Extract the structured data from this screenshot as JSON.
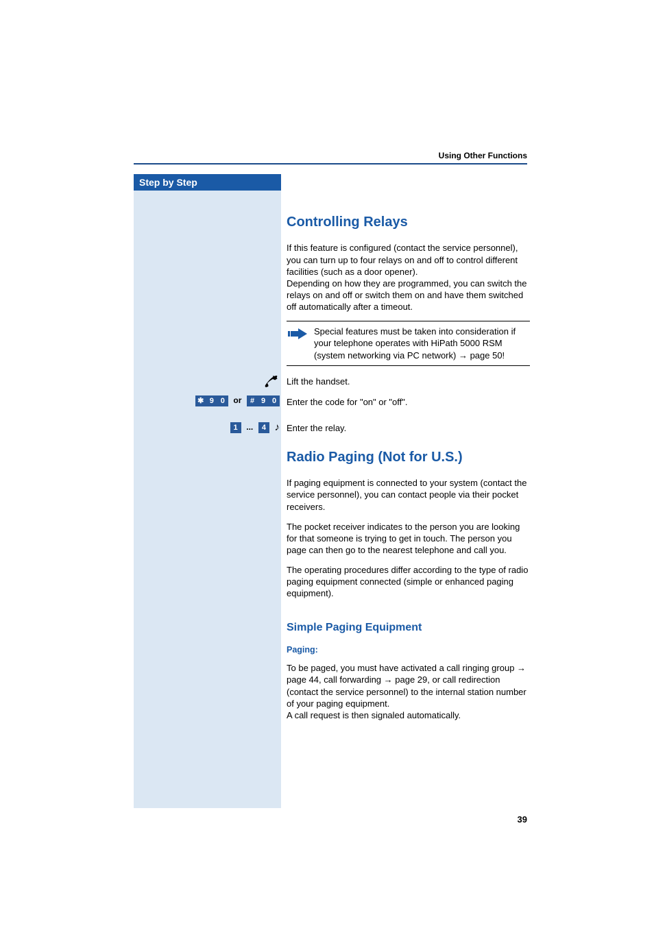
{
  "header": {
    "section": "Using Other Functions"
  },
  "sidebar": {
    "title": "Step by Step"
  },
  "content": {
    "h1a": "Controlling Relays",
    "p1a": "If this feature is configured (contact the service personnel), you can turn up to four relays on and off to control different facilities (such as a door opener).",
    "p1b": "Depending on how they are programmed, you can switch the relays on and off or switch them on and have them switched off automatically after a timeout.",
    "note1": "Special features must be taken into consideration if your telephone operates with HiPath 5000 RSM (system networking via PC network) ",
    "note1_link": "→ page 50!",
    "step1": "Lift the handset.",
    "step2": "Enter the code for \"on\" or \"off\".",
    "step2_or": "or",
    "step3": "Enter the relay.",
    "step3_dots": "...",
    "h1b": "Radio Paging (Not for U.S.)",
    "p2": "If paging equipment is connected to your system (contact the service personnel), you can contact people via their pocket receivers.",
    "p3": "The pocket receiver indicates to the person you are looking for that someone is trying to get in touch. The person you page can then go to the nearest telephone and call you.",
    "p4": "The operating procedures differ according to the type of radio paging equipment connected (simple or enhanced paging equipment).",
    "h2a": "Simple Paging Equipment",
    "h3a": "Paging:",
    "p5a": "To be paged, you must have activated a call ringing group ",
    "p5b": "→ page 44",
    "p5c": ", call forwarding ",
    "p5d": "→ page 29",
    "p5e": ", or call redirection (contact the service personnel) to the internal station number of your paging equipment.",
    "p5f": "A call request is then signaled automatically."
  },
  "keys": {
    "star": "✱",
    "hash": "#",
    "k0": "0",
    "k1": "1",
    "k4": "4",
    "k9": "9"
  },
  "page_number": "39"
}
